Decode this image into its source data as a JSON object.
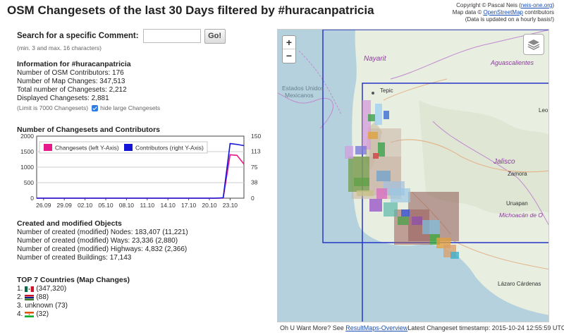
{
  "title": "OSM Changesets of the last 30 Days filtered by #huracanpatricia",
  "credits": {
    "line1_prefix": "Copyright © Pascal Neis (",
    "line1_link": "neis-one.org",
    "line1_suffix": ")",
    "line2_prefix": "Map data © ",
    "line2_link": "OpenStreetMap",
    "line2_suffix": " contributors",
    "line3": "(Data is updated on a hourly basis!)"
  },
  "search": {
    "label": "Search for a specific Comment:",
    "value": "",
    "button": "Go!",
    "hint": "(min. 3 and max. 16 characters)"
  },
  "info": {
    "heading": "Information for #huracanpatricia",
    "contributors": "Number of OSM Contributors: 176",
    "map_changes": "Number of Map Changes: 347,513",
    "total_changesets": "Total number of Changesets: 2,212",
    "displayed_changesets": "Displayed Changesets: 2,881",
    "limit_note": "(Limit is 7000 Changesets)",
    "hide_large_label": "hide large Changesets",
    "hide_large_checked": true
  },
  "chart_data": {
    "type": "line",
    "title": "Number of Changesets and Contributors",
    "x": [
      "26.09",
      "29.09",
      "02.10",
      "05.10",
      "08.10",
      "11.10",
      "14.10",
      "17.10",
      "20.10",
      "23.10"
    ],
    "xlim_days": [
      0,
      30
    ],
    "left_ylim": [
      0,
      2000
    ],
    "left_yticks": [
      "0",
      "500",
      "1000",
      "1500",
      "2000"
    ],
    "right_ylim": [
      0,
      150
    ],
    "right_yticks": [
      "0",
      "38",
      "75",
      "113",
      "150"
    ],
    "series": [
      {
        "name": "Changesets (left Y-Axis)",
        "color": "#e6198c",
        "axis": "left",
        "points": [
          [
            0,
            0
          ],
          [
            1,
            0
          ],
          [
            2,
            0
          ],
          [
            3,
            0
          ],
          [
            4,
            0
          ],
          [
            5,
            0
          ],
          [
            6,
            0
          ],
          [
            7,
            0
          ],
          [
            8,
            0
          ],
          [
            9,
            0
          ],
          [
            10,
            0
          ],
          [
            11,
            0
          ],
          [
            12,
            0
          ],
          [
            13,
            0
          ],
          [
            14,
            0
          ],
          [
            15,
            0
          ],
          [
            16,
            0
          ],
          [
            17,
            0
          ],
          [
            18,
            0
          ],
          [
            19,
            0
          ],
          [
            20,
            0
          ],
          [
            21,
            0
          ],
          [
            22,
            0
          ],
          [
            23,
            0
          ],
          [
            24,
            0
          ],
          [
            25,
            0
          ],
          [
            26,
            0
          ],
          [
            27,
            5
          ],
          [
            28,
            1400
          ],
          [
            29,
            1380
          ],
          [
            30,
            1100
          ]
        ]
      },
      {
        "name": "Contributors (right Y-Axis)",
        "color": "#1414d6",
        "axis": "right",
        "points": [
          [
            0,
            0
          ],
          [
            1,
            0
          ],
          [
            2,
            0
          ],
          [
            3,
            0
          ],
          [
            4,
            0
          ],
          [
            5,
            0
          ],
          [
            6,
            0
          ],
          [
            7,
            0
          ],
          [
            8,
            0
          ],
          [
            9,
            0
          ],
          [
            10,
            0
          ],
          [
            11,
            0
          ],
          [
            12,
            0
          ],
          [
            13,
            0
          ],
          [
            14,
            0
          ],
          [
            15,
            0
          ],
          [
            16,
            0
          ],
          [
            17,
            0
          ],
          [
            18,
            0
          ],
          [
            19,
            0
          ],
          [
            20,
            0
          ],
          [
            21,
            0
          ],
          [
            22,
            0
          ],
          [
            23,
            0
          ],
          [
            24,
            0
          ],
          [
            25,
            0
          ],
          [
            26,
            0
          ],
          [
            27,
            1
          ],
          [
            28,
            132
          ],
          [
            29,
            130
          ],
          [
            30,
            127
          ]
        ]
      }
    ],
    "legend": "top-right"
  },
  "created": {
    "heading": "Created and modified Objects",
    "nodes": "Number of created (modified) Nodes: 183,407 (11,221)",
    "ways": "Number of created (modified) Ways: 23,336 (2,880)",
    "highways": "Number of created (modified) Highways: 4,832 (2,366)",
    "buildings": "Number of created Buildings: 17,143"
  },
  "countries": {
    "heading": "TOP 7 Countries (Map Changes)",
    "items": [
      {
        "rank": "1.",
        "flag": "mexico",
        "value": "(347,320)"
      },
      {
        "rank": "2.",
        "flag": "gambia",
        "value": "(88)"
      },
      {
        "rank": "3.",
        "flag": "",
        "value": "unknown (73)"
      },
      {
        "rank": "4.",
        "flag": "niger",
        "value": "(32)"
      }
    ]
  },
  "map": {
    "zoom_in": "+",
    "zoom_out": "−",
    "labels": {
      "nayarit": "Nayarit",
      "estados1": "Estados Unidos",
      "estados2": "Mexicanos",
      "aguascalientes": "Aguascalientes",
      "tepic": "Tepic",
      "jalisco": "Jalisco",
      "zamora": "Zamora",
      "uruapan": "Uruapan",
      "michoacan": "Michoacán de O",
      "lazaro": "Lázaro Cárdenas",
      "leo": "Leo"
    }
  },
  "footer": {
    "prefix": "Oh U Want More? See ",
    "link": "ResultMaps-Overview",
    "suffix": "Latest Changeset timestamp: 2015-10-24 12:55:59 UTC"
  }
}
